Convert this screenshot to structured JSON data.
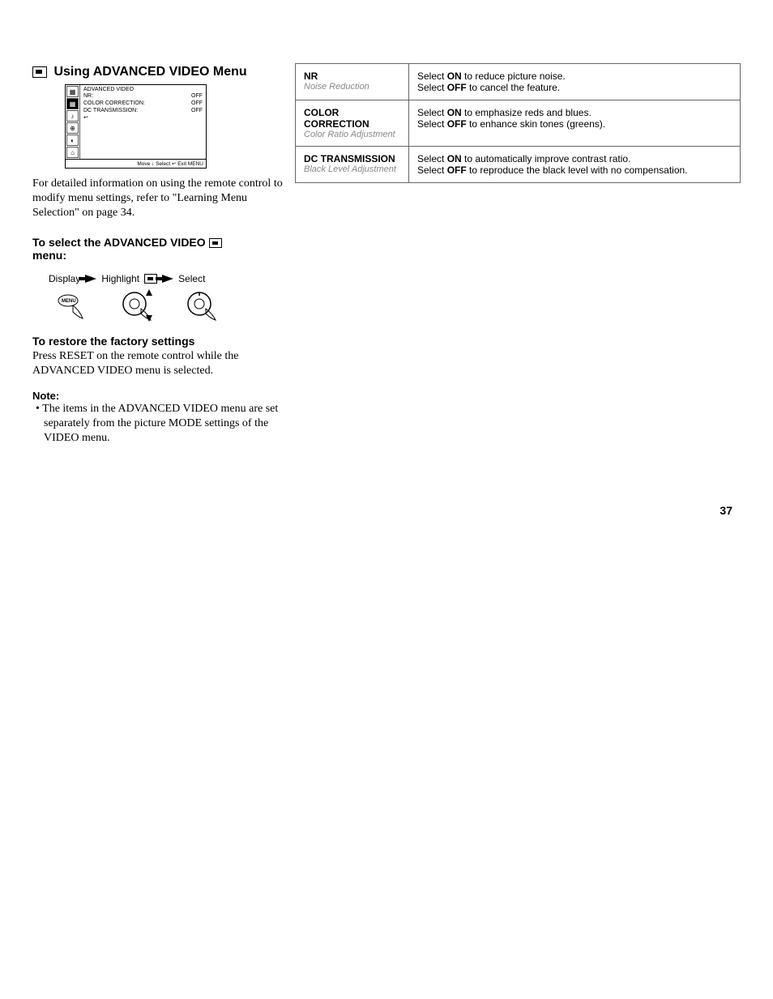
{
  "page_number": "37",
  "left": {
    "title": "Using ADVANCED VIDEO Menu",
    "osd": {
      "header": "ADVANCED VIDEO",
      "rows": [
        {
          "name": "NR:",
          "val": "OFF"
        },
        {
          "name": "COLOR CORRECTION:",
          "val": "OFF"
        },
        {
          "name": "DC TRANSMISSION:",
          "val": "OFF"
        }
      ],
      "footer": "Move ↕   Select ↵   Exit MENU"
    },
    "intro": "For detailed information on using the remote control to modify menu settings, refer to \"Learning Menu Selection\" on page 34.",
    "select_head": "To select the ADVANCED VIDEO",
    "select_head_suffix": "menu:",
    "flow": {
      "display": "Display",
      "highlight": "Highlight",
      "select": "Select"
    },
    "restore_head": "To restore the factory settings",
    "restore_para": "Press RESET on the remote control while the ADVANCED VIDEO menu is selected.",
    "note_head": "Note:",
    "note_bullet": "• The items in the ADVANCED VIDEO menu are set separately from the picture MODE settings of the VIDEO menu."
  },
  "table": [
    {
      "title": "NR",
      "sub": "Noise Reduction",
      "desc_on": "Select <b>ON</b> to reduce picture noise.",
      "desc_off": "Select <b>OFF</b> to cancel the feature."
    },
    {
      "title": "COLOR CORRECTION",
      "sub": "Color Ratio Adjustment",
      "desc_on": "Select <b>ON</b> to emphasize reds and blues.",
      "desc_off": "Select <b>OFF</b> to enhance skin tones (greens)."
    },
    {
      "title": "DC TRANSMISSION",
      "sub": "Black Level Adjustment",
      "desc_on": "Select <b>ON</b> to automatically improve contrast ratio.",
      "desc_off": "Select <b>OFF</b> to reproduce the black level with no compensation."
    }
  ]
}
